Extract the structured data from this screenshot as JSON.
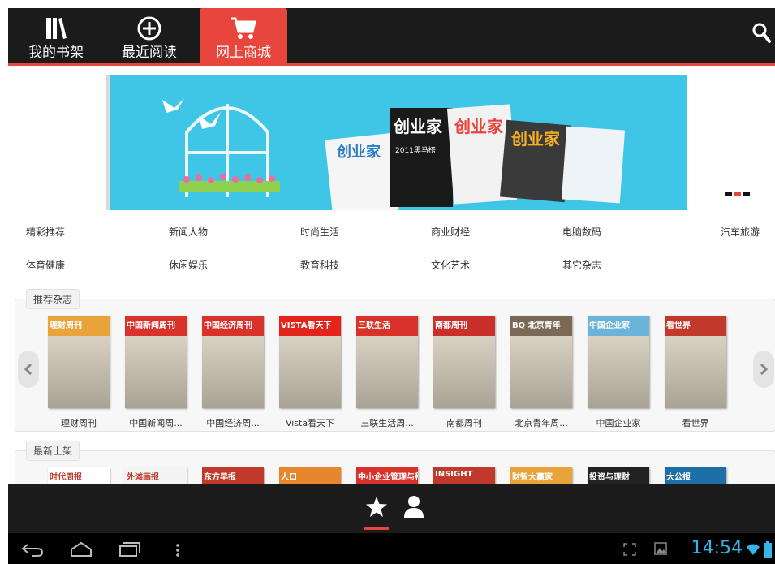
{
  "tabs": [
    {
      "label": "我的书架",
      "icon": "bookshelf-icon"
    },
    {
      "label": "最近阅读",
      "icon": "recent-reading-icon"
    },
    {
      "label": "网上商城",
      "icon": "shopping-cart-icon",
      "active": true
    }
  ],
  "banner": {
    "text_covers": [
      "创业家",
      "创业家",
      "创业家",
      "创业家"
    ],
    "sub_label": "2011黑马榜",
    "page_indicator": {
      "count": 3,
      "active": 1
    }
  },
  "categories": [
    "精彩推荐",
    "新闻人物",
    "时尚生活",
    "商业财经",
    "电脑数码",
    "汽车旅游",
    "体育健康",
    "休闲娱乐",
    "教育科技",
    "文化艺术",
    "其它杂志"
  ],
  "recommended": {
    "title": "推荐杂志",
    "items": [
      {
        "name": "理财周刊",
        "cover_title": "理财周刊",
        "color": "#e9a33b"
      },
      {
        "name": "中国新闻周...",
        "cover_title": "中国新闻周刊",
        "color": "#d8322b"
      },
      {
        "name": "中国经济周...",
        "cover_title": "中国经济周刊",
        "color": "#d8322b"
      },
      {
        "name": "Vista看天下",
        "cover_title": "VISTA看天下",
        "color": "#e2241b"
      },
      {
        "name": "三联生活周...",
        "cover_title": "三联生活",
        "color": "#d8322b"
      },
      {
        "name": "南都周刊",
        "cover_title": "南都周刊",
        "color": "#c9302c"
      },
      {
        "name": "北京青年周...",
        "cover_title": "BQ 北京青年",
        "color": "#7a6a55"
      },
      {
        "name": "中国企业家",
        "cover_title": "中国企业家",
        "color": "#6bb3d8"
      },
      {
        "name": "看世界",
        "cover_title": "看世界",
        "color": "#c0392b"
      }
    ]
  },
  "newest": {
    "title": "最新上架",
    "items": [
      {
        "cover_title": "时代周报",
        "color": "#ffffff"
      },
      {
        "cover_title": "外滩画报",
        "color": "#f4f4f4"
      },
      {
        "cover_title": "东方早报",
        "color": "#c0392b"
      },
      {
        "cover_title": "人口",
        "color": "#e8862e"
      },
      {
        "cover_title": "中小企业管理与科技",
        "color": "#d8322b"
      },
      {
        "cover_title": "INSIGHT",
        "color": "#c0392b"
      },
      {
        "cover_title": "财智大赢家",
        "color": "#e9a33b"
      },
      {
        "cover_title": "投资与理财",
        "color": "#222222"
      },
      {
        "cover_title": "大公报",
        "color": "#1e6fa8"
      }
    ]
  },
  "bottom_nav": [
    {
      "icon": "star-icon",
      "active": true
    },
    {
      "icon": "person-icon",
      "active": false
    }
  ],
  "system_bar": {
    "clock": "14:54"
  },
  "colors": {
    "accent": "#e8453c",
    "topbar": "#1b1b1b",
    "banner_bg": "#3fc5e6",
    "clock": "#33b5e5"
  }
}
